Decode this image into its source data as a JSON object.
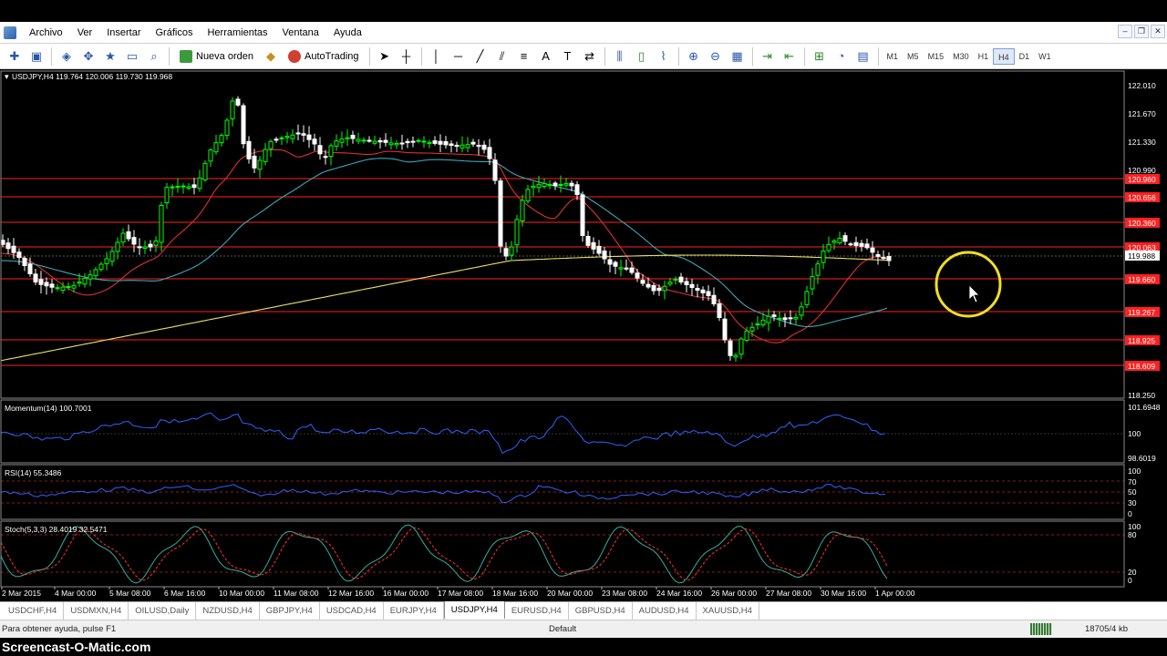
{
  "menu": {
    "items": [
      "Archivo",
      "Ver",
      "Insertar",
      "Gráficos",
      "Herramientas",
      "Ventana",
      "Ayuda"
    ]
  },
  "toolbar": {
    "new_order_label": "Nueva orden",
    "autotrading_label": "AutoTrading",
    "timeframes": [
      "M1",
      "M5",
      "M15",
      "M30",
      "H1",
      "H4",
      "D1",
      "W1"
    ],
    "active_timeframe": "H4"
  },
  "chart": {
    "header": "USDJPY,H4  119.764 120.006 119.730 119.968",
    "price_axis_labels": [
      "122.010",
      "121.670",
      "121.330",
      "120.990",
      "120.650",
      "119.988",
      "118.250"
    ],
    "hline_labels": [
      "120.960",
      "120.656",
      "120.360",
      "120.063",
      "119.660",
      "119.267",
      "118.925",
      "118.609"
    ],
    "time_labels": [
      "2 Mar 2015",
      "4 Mar 00:00",
      "5 Mar 08:00",
      "6 Mar 16:00",
      "10 Mar 00:00",
      "11 Mar 08:00",
      "12 Mar 16:00",
      "16 Mar 00:00",
      "17 Mar 08:00",
      "18 Mar 16:00",
      "20 Mar 00:00",
      "23 Mar 08:00",
      "24 Mar 16:00",
      "26 Mar 00:00",
      "27 Mar 08:00",
      "30 Mar 16:00",
      "1 Apr 00:00"
    ],
    "momentum": {
      "label": "Momentum(14) 100.7001",
      "scale": [
        "101.6948",
        "100",
        "98.6019"
      ]
    },
    "rsi": {
      "label": "RSI(14) 55.3486",
      "scale": [
        "100",
        "70",
        "50",
        "30",
        "0"
      ]
    },
    "stoch": {
      "label": "Stoch(5,3,3) 28.4019 32.5471",
      "scale": [
        "100",
        "80",
        "20",
        "0"
      ]
    },
    "colors": {
      "bull": "#00ff00",
      "bear": "#ffffff",
      "ma_fast": "#e03030",
      "ma_mid": "#3aa8b8",
      "ma_slow": "#e8e060",
      "hline": "#ff2020",
      "momentum": "#3060ff",
      "stoch_main": "#30b0a0",
      "stoch_signal": "#ff3030"
    }
  },
  "tabs": {
    "items": [
      "USDCHF,H4",
      "USDMXN,H4",
      "OILUSD,Daily",
      "NZDUSD,H4",
      "GBPJPY,H4",
      "USDCAD,H4",
      "EURJPY,H4",
      "USDJPY,H4",
      "EURUSD,H4",
      "GBPUSD,H4",
      "AUDUSD,H4",
      "XAUUSD,H4"
    ],
    "active": "USDJPY,H4"
  },
  "status": {
    "help": "Para obtener ayuda, pulse F1",
    "profile": "Default",
    "traffic": "18705/4 kb"
  },
  "watermark": "Screencast-O-Matic.com"
}
